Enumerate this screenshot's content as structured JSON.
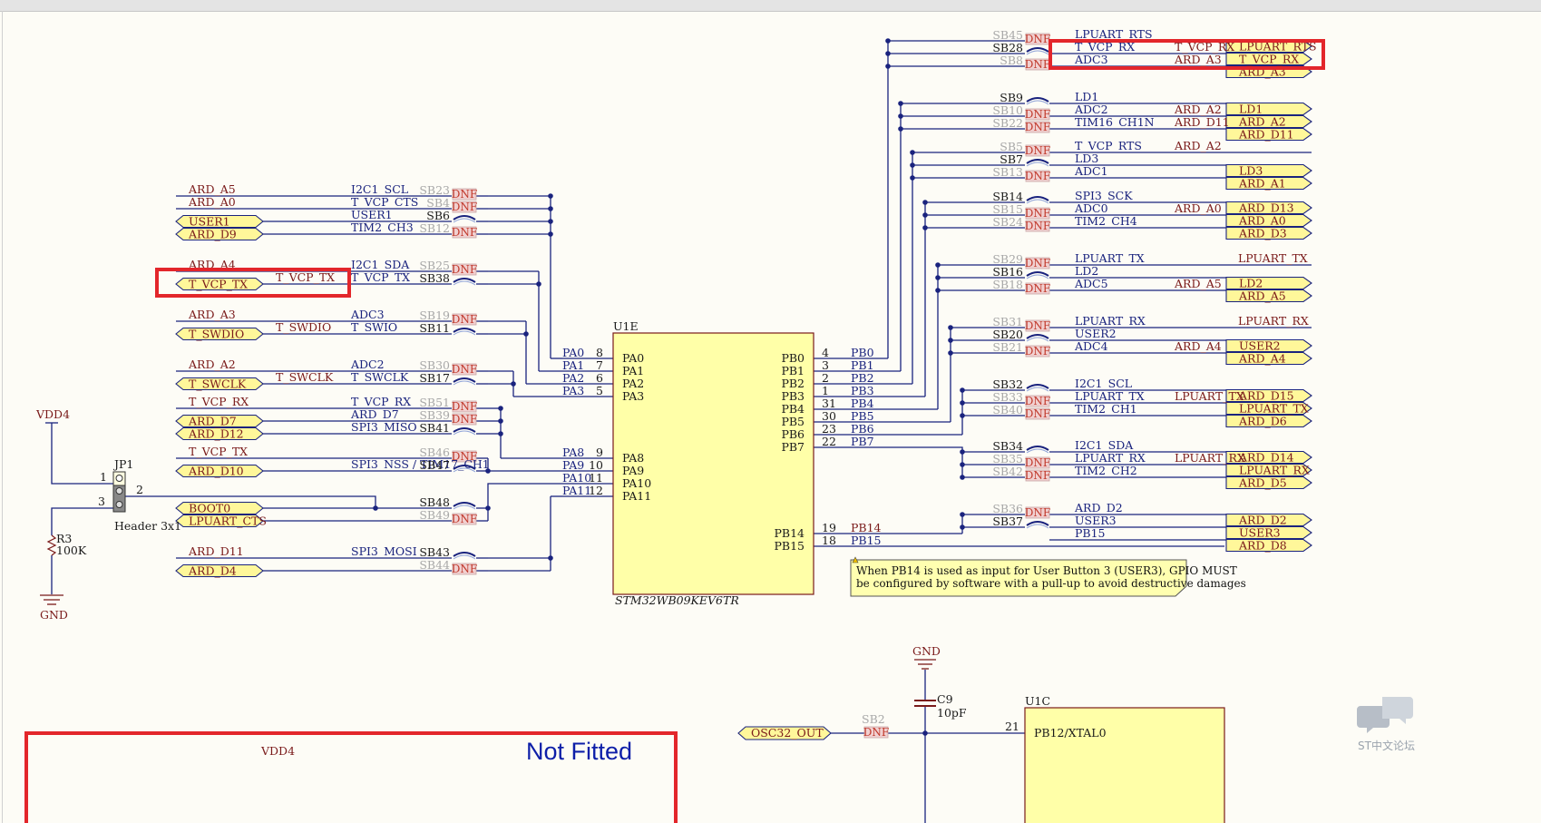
{
  "mcu": {
    "designator": "U1E",
    "part": "STM32WB09KEV6TR",
    "left_pins": [
      {
        "num": "8",
        "name": "PA0",
        "net": "PA0"
      },
      {
        "num": "7",
        "name": "PA1",
        "net": "PA1"
      },
      {
        "num": "6",
        "name": "PA2",
        "net": "PA2"
      },
      {
        "num": "5",
        "name": "PA3",
        "net": "PA3"
      },
      {
        "num": "9",
        "name": "PA8",
        "net": "PA8"
      },
      {
        "num": "10",
        "name": "PA9",
        "net": "PA9"
      },
      {
        "num": "11",
        "name": "PA10",
        "net": "PA10"
      },
      {
        "num": "12",
        "name": "PA11",
        "net": "PA11"
      }
    ],
    "right_pins": [
      {
        "num": "4",
        "name": "PB0",
        "net": "PB0"
      },
      {
        "num": "3",
        "name": "PB1",
        "net": "PB1"
      },
      {
        "num": "2",
        "name": "PB2",
        "net": "PB2"
      },
      {
        "num": "1",
        "name": "PB3",
        "net": "PB3"
      },
      {
        "num": "31",
        "name": "PB4",
        "net": "PB4"
      },
      {
        "num": "30",
        "name": "PB5",
        "net": "PB5"
      },
      {
        "num": "23",
        "name": "PB6",
        "net": "PB6"
      },
      {
        "num": "22",
        "name": "PB7",
        "net": "PB7"
      },
      {
        "num": "19",
        "name": "PB14",
        "net": "PB14"
      },
      {
        "num": "18",
        "name": "PB15",
        "net": "PB15"
      }
    ]
  },
  "left_rows": [
    {
      "net": "ARD_A5",
      "port": "",
      "mid": "",
      "sig": "I2C1_SCL",
      "sb": "SB23",
      "dnf": true
    },
    {
      "net": "ARD_A0",
      "port": "",
      "mid": "",
      "sig": "T_VCP_CTS",
      "sb": "SB4",
      "dnf": true
    },
    {
      "net": "",
      "port": "USER1",
      "mid": "",
      "sig": "USER1",
      "sb": "SB6",
      "dnf": false
    },
    {
      "net": "",
      "port": "ARD_D9",
      "mid": "",
      "sig": "TIM2_CH3",
      "sb": "SB12",
      "dnf": true
    },
    {
      "net": "ARD_A4",
      "port": "",
      "mid": "",
      "sig": "I2C1_SDA",
      "sb": "SB25",
      "dnf": true
    },
    {
      "net": "",
      "port": "T_VCP_TX",
      "mid": "T_VCP_TX",
      "sig": "T_VCP_TX",
      "sb": "SB38",
      "dnf": false
    },
    {
      "net": "ARD_A3",
      "port": "",
      "mid": "",
      "sig": "ADC3",
      "sb": "SB19",
      "dnf": true
    },
    {
      "net": "",
      "port": "T_SWDIO",
      "mid": "T_SWDIO",
      "sig": "T_SWIO",
      "sb": "SB11",
      "dnf": false
    },
    {
      "net": "ARD_A2",
      "port": "",
      "mid": "",
      "sig": "ADC2",
      "sb": "SB30",
      "dnf": true
    },
    {
      "net": "",
      "port": "T_SWCLK",
      "mid": "T_SWCLK",
      "sig": "T_SWCLK",
      "sb": "SB17",
      "dnf": false
    },
    {
      "net": "T_VCP_RX",
      "port": "",
      "mid": "",
      "sig": "T_VCP_RX",
      "sb": "SB51",
      "dnf": true
    },
    {
      "net": "",
      "port": "ARD_D7",
      "mid": "",
      "sig": "ARD_D7",
      "sb": "SB39",
      "dnf": true
    },
    {
      "net": "",
      "port": "ARD_D12",
      "mid": "",
      "sig": "SPI3_MISO",
      "sb": "SB41",
      "dnf": false
    },
    {
      "net": "T_VCP_TX",
      "port": "",
      "mid": "",
      "sig": "",
      "sb": "SB46",
      "dnf": true
    },
    {
      "net": "",
      "port": "ARD_D10",
      "mid": "",
      "sig": "SPI3_NSS / TIM17_CH1",
      "sb": "SB47",
      "dnf": false
    },
    {
      "net": "",
      "port": "BOOT0",
      "mid": "",
      "sig": "",
      "sb": "SB48",
      "dnf": false
    },
    {
      "net": "",
      "port": "LPUART_CTS",
      "mid": "",
      "sig": "",
      "sb": "SB49",
      "dnf": true
    },
    {
      "net": "ARD_D11",
      "port": "",
      "mid": "",
      "sig": "SPI3_MOSI",
      "sb": "SB43",
      "dnf": false
    },
    {
      "net": "",
      "port": "ARD_D4",
      "mid": "",
      "sig": "",
      "sb": "SB44",
      "dnf": true
    }
  ],
  "right_rows": [
    {
      "sb": "SB45",
      "dnf": true,
      "sig": "LPUART_RTS",
      "mid": "",
      "port": "LPUART_RTS"
    },
    {
      "sb": "SB28",
      "dnf": false,
      "sig": "T_VCP_RX",
      "mid": "T_VCP_RX",
      "port": "T_VCP_RX"
    },
    {
      "sb": "SB8",
      "dnf": true,
      "sig": "ADC3",
      "mid": "ARD_A3",
      "port": "ARD_A3"
    },
    {
      "sb": "SB9",
      "dnf": false,
      "sig": "LD1",
      "mid": "",
      "port": "LD1"
    },
    {
      "sb": "SB10",
      "dnf": true,
      "sig": "ADC2",
      "mid": "ARD_A2",
      "port": "ARD_A2"
    },
    {
      "sb": "SB22",
      "dnf": true,
      "sig": "TIM16_CH1N",
      "mid": "ARD_D11",
      "port": "ARD_D11"
    },
    {
      "sb": "SB5",
      "dnf": true,
      "sig": "T_VCP_RTS",
      "mid": "ARD_A2",
      "port": ""
    },
    {
      "sb": "SB7",
      "dnf": false,
      "sig": "LD3",
      "mid": "",
      "port": "LD3"
    },
    {
      "sb": "SB13",
      "dnf": true,
      "sig": "ADC1",
      "mid": "",
      "port": "ARD_A1"
    },
    {
      "sb": "SB14",
      "dnf": false,
      "sig": "SPI3_SCK",
      "mid": "",
      "port": "ARD_D13"
    },
    {
      "sb": "SB15",
      "dnf": true,
      "sig": "ADC0",
      "mid": "ARD_A0",
      "port": "ARD_A0"
    },
    {
      "sb": "SB24",
      "dnf": true,
      "sig": "TIM2_CH4",
      "mid": "",
      "port": "ARD_D3"
    },
    {
      "sb": "SB29",
      "dnf": true,
      "sig": "LPUART_TX",
      "mid": "",
      "port": "LPUART_TX",
      "plain": true
    },
    {
      "sb": "SB16",
      "dnf": false,
      "sig": "LD2",
      "mid": "",
      "port": "LD2"
    },
    {
      "sb": "SB18",
      "dnf": true,
      "sig": "ADC5",
      "mid": "ARD_A5",
      "port": "ARD_A5"
    },
    {
      "sb": "SB31",
      "dnf": true,
      "sig": "LPUART_RX",
      "mid": "",
      "port": "LPUART_RX",
      "plain": true
    },
    {
      "sb": "SB20",
      "dnf": false,
      "sig": "USER2",
      "mid": "",
      "port": "USER2"
    },
    {
      "sb": "SB21",
      "dnf": true,
      "sig": "ADC4",
      "mid": "ARD_A4",
      "port": "ARD_A4"
    },
    {
      "sb": "SB32",
      "dnf": false,
      "sig": "I2C1_SCL",
      "mid": "",
      "port": "ARD_D15"
    },
    {
      "sb": "SB33",
      "dnf": true,
      "sig": "LPUART_TX",
      "mid": "LPUART_TX",
      "port": "LPUART_TX"
    },
    {
      "sb": "SB40",
      "dnf": true,
      "sig": "TIM2_CH1",
      "mid": "",
      "port": "ARD_D6"
    },
    {
      "sb": "SB34",
      "dnf": false,
      "sig": "I2C1_SDA",
      "mid": "",
      "port": "ARD_D14"
    },
    {
      "sb": "SB35",
      "dnf": true,
      "sig": "LPUART_RX",
      "mid": "LPUART_RX",
      "port": "LPUART_RX"
    },
    {
      "sb": "SB42",
      "dnf": true,
      "sig": "TIM2_CH2",
      "mid": "",
      "port": "ARD_D5"
    },
    {
      "sb": "SB36",
      "dnf": true,
      "sig": "ARD_D2",
      "mid": "",
      "port": "ARD_D2"
    },
    {
      "sb": "SB37",
      "dnf": false,
      "sig": "USER3",
      "mid": "",
      "port": "USER3"
    },
    {
      "sb": "",
      "dnf": false,
      "sig": "PB15",
      "mid": "",
      "port": "ARD_D8"
    }
  ],
  "dnf_label": "DNF",
  "jumper": {
    "designator": "JP1",
    "part": "Header 3x1",
    "pin1": "1",
    "pin2": "2",
    "pin3": "3",
    "supply": "VDD4"
  },
  "resistor": {
    "designator": "R3",
    "value": "100K",
    "ground": "GND"
  },
  "note": {
    "line1": "When PB14 is used as input for User Button 3 (USER3), GPIO MUST",
    "line2": "be configured by software with a pull-up to avoid destructive damages"
  },
  "osc": {
    "ground": "GND",
    "cap": "C9",
    "cap_value": "10pF",
    "port": "OSC32_OUT",
    "sb": "SB2",
    "chip": "U1C",
    "pin_num": "21",
    "pin_name": "PB12/XTAL0"
  },
  "bottom_box": {
    "supply": "VDD4",
    "title": "Not Fitted"
  },
  "watermark": "ST中文论坛"
}
